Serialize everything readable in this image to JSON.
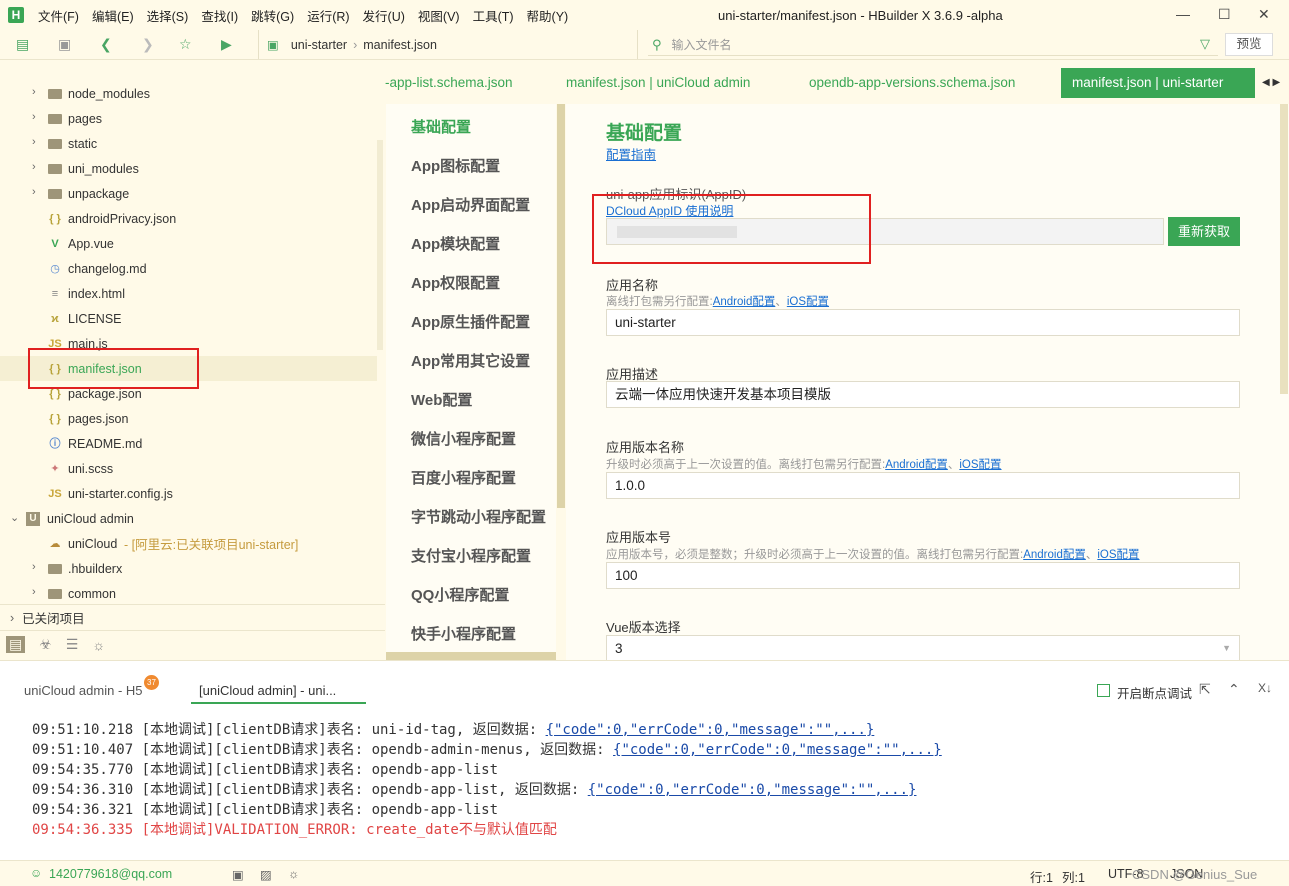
{
  "menubar": [
    "文件(F)",
    "编辑(E)",
    "选择(S)",
    "查找(I)",
    "跳转(G)",
    "运行(R)",
    "发行(U)",
    "视图(V)",
    "工具(T)",
    "帮助(Y)"
  ],
  "window_title": "uni-starter/manifest.json - HBuilder X 3.6.9 -alpha",
  "logo": "H",
  "breadcrumb": {
    "project": "uni-starter",
    "file": "manifest.json"
  },
  "file_search": {
    "placeholder": "输入文件名"
  },
  "preview_label": "预览",
  "tree": [
    {
      "label": "node_modules",
      "type": "folder"
    },
    {
      "label": "pages",
      "type": "folder"
    },
    {
      "label": "static",
      "type": "folder"
    },
    {
      "label": "uni_modules",
      "type": "folder"
    },
    {
      "label": "unpackage",
      "type": "folder"
    },
    {
      "label": "androidPrivacy.json",
      "type": "json"
    },
    {
      "label": "App.vue",
      "type": "vue"
    },
    {
      "label": "changelog.md",
      "type": "md"
    },
    {
      "label": "index.html",
      "type": "html"
    },
    {
      "label": "LICENSE",
      "type": "license"
    },
    {
      "label": "main.js",
      "type": "js"
    },
    {
      "label": "manifest.json",
      "type": "json",
      "selected": true
    },
    {
      "label": "package.json",
      "type": "json"
    },
    {
      "label": "pages.json",
      "type": "json"
    },
    {
      "label": "README.md",
      "type": "info"
    },
    {
      "label": "uni.scss",
      "type": "scss"
    },
    {
      "label": "uni-starter.config.js",
      "type": "js"
    },
    {
      "label": "uniCloud admin",
      "type": "project"
    },
    {
      "label": "uniCloud",
      "type": "cloud",
      "note": "- [阿里云:已关联项目uni-starter]"
    },
    {
      "label": ".hbuilderx",
      "type": "folder"
    },
    {
      "label": "common",
      "type": "folder"
    }
  ],
  "closed_projects": "已关闭项目",
  "tabs": [
    {
      "label": "-app-list.schema.json"
    },
    {
      "label": "manifest.json | uniCloud admin"
    },
    {
      "label": "opendb-app-versions.schema.json"
    },
    {
      "label": "manifest.json | uni-starter",
      "active": true
    }
  ],
  "nav": [
    "基础配置",
    "App图标配置",
    "App启动界面配置",
    "App模块配置",
    "App权限配置",
    "App原生插件配置",
    "App常用其它设置",
    "Web配置",
    "微信小程序配置",
    "百度小程序配置",
    "字节跳动小程序配置",
    "支付宝小程序配置",
    "QQ小程序配置",
    "快手小程序配置"
  ],
  "form": {
    "section_title": "基础配置",
    "guide_link": "配置指南",
    "appid_label": "uni-app应用标识(AppID)",
    "appid_link": "DCloud AppID 使用说明",
    "appid_value": "",
    "refresh_label": "重新获取",
    "name_label": "应用名称",
    "offline_hint": "离线打包需另行配置:",
    "android_link": "Android配置",
    "sep": "、",
    "ios_link": "iOS配置",
    "name_value": "uni-starter",
    "desc_label": "应用描述",
    "desc_value": "云端一体应用快速开发基本项目模版",
    "vname_label": "应用版本名称",
    "vname_hint": "升级时必须高于上一次设置的值。离线打包需另行配置:",
    "vname_value": "1.0.0",
    "vcode_label": "应用版本号",
    "vcode_hint": "应用版本号，必须是整数；升级时必须高于上一次设置的值。离线打包需另行配置:",
    "vcode_value": "100",
    "vue_label": "Vue版本选择",
    "vue_value": "3"
  },
  "console": {
    "tab1": "uniCloud admin - H5",
    "badge": "37",
    "tab2": "[uniCloud admin] - uni...",
    "breakpoint_label": "开启断点调试",
    "lines": [
      {
        "text": "09:51:10.218 [本地调试][clientDB请求]表名: uni-id-tag, 返回数据: ",
        "link": "{\"code\":0,\"errCode\":0,\"message\":\"\",...}"
      },
      {
        "text": "09:51:10.407 [本地调试][clientDB请求]表名: opendb-admin-menus, 返回数据: ",
        "link": "{\"code\":0,\"errCode\":0,\"message\":\"\",...}"
      },
      {
        "text": "09:54:35.770 [本地调试][clientDB请求]表名: opendb-app-list",
        "link": ""
      },
      {
        "text": "09:54:36.310 [本地调试][clientDB请求]表名: opendb-app-list, 返回数据: ",
        "link": "{\"code\":0,\"errCode\":0,\"message\":\"\",...}"
      },
      {
        "text": "09:54:36.321 [本地调试][clientDB请求]表名: opendb-app-list",
        "link": ""
      },
      {
        "text": "09:54:36.335 [本地调试]VALIDATION_ERROR: create_date不与默认值匹配",
        "link": "",
        "error": true
      }
    ]
  },
  "status": {
    "user": "1420779618@qq.com",
    "line": "行:1",
    "col": "列:1",
    "encoding": "UTF-8",
    "lang": "JSON",
    "watermark": "CSDN @Genius_Sue"
  },
  "colors": {
    "accent": "#3aa655",
    "background": "#fffae8",
    "link": "#1a6fd2",
    "error": "#e04545",
    "highlight_box": "#e02020"
  }
}
